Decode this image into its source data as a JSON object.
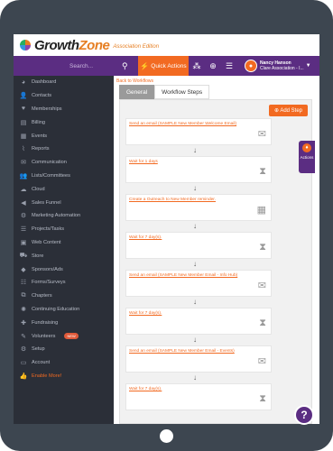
{
  "app": {
    "logo_text_1": "Growth",
    "logo_text_2": "Zone",
    "edition": "Association Edition"
  },
  "header": {
    "search_placeholder": "Search...",
    "quick_actions": "Quick Actions",
    "user_name": "Nancy Hanson",
    "user_org": "Clare Association - I..."
  },
  "sidebar": {
    "items": [
      {
        "label": "Dashboard",
        "icon": "dashboard-icon",
        "glyph": "◕"
      },
      {
        "label": "Contacts",
        "icon": "contacts-icon",
        "glyph": "👤"
      },
      {
        "label": "Memberships",
        "icon": "heart-icon",
        "glyph": "♥"
      },
      {
        "label": "Billing",
        "icon": "billing-icon",
        "glyph": "▤"
      },
      {
        "label": "Events",
        "icon": "calendar-icon",
        "glyph": "▦"
      },
      {
        "label": "Reports",
        "icon": "chart-icon",
        "glyph": "⌇"
      },
      {
        "label": "Communication",
        "icon": "envelope-icon",
        "glyph": "✉"
      },
      {
        "label": "Lists/Committees",
        "icon": "users-icon",
        "glyph": "👥"
      },
      {
        "label": "Cloud",
        "icon": "cloud-icon",
        "glyph": "☁"
      },
      {
        "label": "Sales Funnel",
        "icon": "funnel-icon",
        "glyph": "◀"
      },
      {
        "label": "Marketing Automation",
        "icon": "gear-icon",
        "glyph": "⚙"
      },
      {
        "label": "Projects/Tasks",
        "icon": "tasks-icon",
        "glyph": "☰"
      },
      {
        "label": "Web Content",
        "icon": "web-icon",
        "glyph": "▣"
      },
      {
        "label": "Store",
        "icon": "cart-icon",
        "glyph": "⛟"
      },
      {
        "label": "Sponsors/Ads",
        "icon": "megaphone-icon",
        "glyph": "◆"
      },
      {
        "label": "Forms/Surveys",
        "icon": "forms-icon",
        "glyph": "☷"
      },
      {
        "label": "Chapters",
        "icon": "sitemap-icon",
        "glyph": "⧉"
      },
      {
        "label": "Continuing Education",
        "icon": "education-icon",
        "glyph": "✺"
      },
      {
        "label": "Fundraising",
        "icon": "gift-icon",
        "glyph": "✚"
      },
      {
        "label": "Volunteers",
        "icon": "wand-icon",
        "glyph": "✎",
        "badge": "NEW"
      },
      {
        "label": "Setup",
        "icon": "settings-icon",
        "glyph": "⚙"
      },
      {
        "label": "Account",
        "icon": "account-icon",
        "glyph": "▭"
      },
      {
        "label": "Enable More!",
        "icon": "thumbs-up-icon",
        "glyph": "👍",
        "highlight": true
      }
    ]
  },
  "main": {
    "back_link": "Back to Workflows",
    "tabs": [
      "General",
      "Workflow Steps"
    ],
    "add_step": "Add Step",
    "actions_label": "Actions",
    "steps": [
      {
        "label": "Send an email (SAMPLE New Member Welcome Email)",
        "icon": "envelope-icon",
        "glyph": "✉"
      },
      {
        "label": "Wait for 1 days",
        "icon": "hourglass-icon",
        "glyph": "⧗"
      },
      {
        "label": "Create a Outreach to New Member reminder.",
        "icon": "calendar-plus-icon",
        "glyph": "▦"
      },
      {
        "label": "Wait for 7 day(s).",
        "icon": "hourglass-icon",
        "glyph": "⧗"
      },
      {
        "label": "Send an email (SAMPLE New Member Email - Info Hub)",
        "icon": "envelope-icon",
        "glyph": "✉"
      },
      {
        "label": "Wait for 7 day(s).",
        "icon": "hourglass-icon",
        "glyph": "⧗"
      },
      {
        "label": "Send an email (SAMPLE New Member Email - Events)",
        "icon": "envelope-icon",
        "glyph": "✉"
      },
      {
        "label": "Wait for 7 day(s).",
        "icon": "hourglass-icon",
        "glyph": "⧗"
      }
    ]
  },
  "help_label": "?"
}
